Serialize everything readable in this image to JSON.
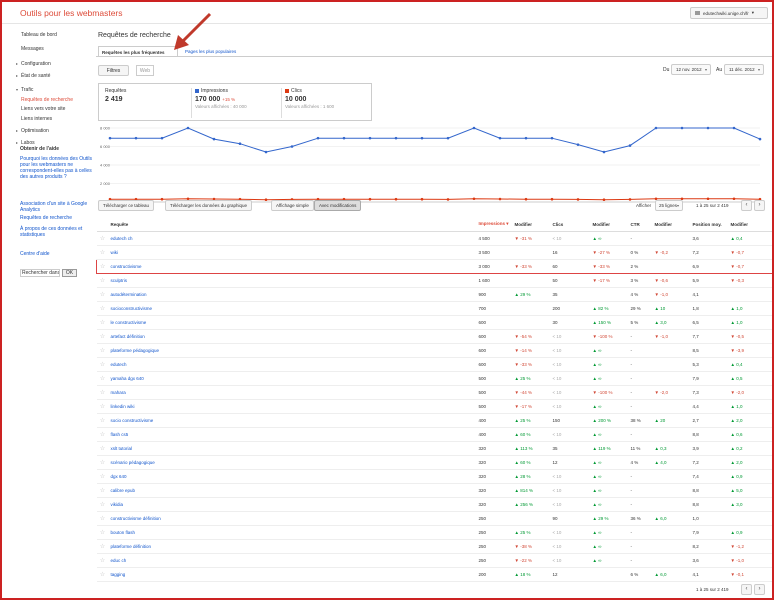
{
  "header": {
    "app_title": "Outils pour les webmasters",
    "account": "edutechwiki.unige.ch/fr"
  },
  "sidebar": {
    "items": [
      {
        "label": "Tableau de bord",
        "type": "top",
        "active": false,
        "arrow": ""
      },
      {
        "label": "Messages",
        "type": "top",
        "active": false,
        "arrow": ""
      },
      {
        "label": "Configuration",
        "type": "sec",
        "active": false,
        "arrow": "▸"
      },
      {
        "label": "État de santé",
        "type": "sec",
        "active": false,
        "arrow": "▸"
      },
      {
        "label": "Trafic",
        "type": "sec",
        "active": false,
        "arrow": "▾"
      },
      {
        "label": "Requêtes de recherche",
        "type": "sub",
        "active": true,
        "arrow": ""
      },
      {
        "label": "Liens vers votre site",
        "type": "sub",
        "active": false,
        "arrow": ""
      },
      {
        "label": "Liens internes",
        "type": "sub",
        "active": false,
        "arrow": ""
      },
      {
        "label": "Optimisation",
        "type": "sec",
        "active": false,
        "arrow": "▸"
      },
      {
        "label": "Labos",
        "type": "sec",
        "active": false,
        "arrow": "▸"
      }
    ],
    "help": {
      "title": "Obtenir de l'aide",
      "links": [
        "Pourquoi les données des Outils pour les webmasters ne correspondent-elles pas à celles des autres produits ?",
        "Association d'un site à Google Analytics",
        "Requêtes de recherche",
        "À propos de ces données et statistiques",
        "Centre d'aide"
      ],
      "search_value": "Rechercher dans",
      "ok_label": "OK"
    }
  },
  "main": {
    "page_title": "Requêtes de recherche",
    "tabs": [
      "Requêtes les plus fréquentes",
      "Pages les plus populaires"
    ],
    "filters_label": "Filtres",
    "web_label": "Web",
    "date": {
      "du_label": "Du",
      "from": "12 nov. 2012",
      "au_label": "Au",
      "to": "11 déc. 2012"
    },
    "kpis": [
      {
        "label": "Requêtes",
        "value": "2 419",
        "delta": "",
        "sub": "",
        "color": ""
      },
      {
        "label": "Impressions",
        "value": "170 000",
        "delta": "+15 %",
        "sub": "Valeurs affichées : 40 000",
        "color": "#3366cc"
      },
      {
        "label": "Clics",
        "value": "10 000",
        "delta": "",
        "sub": "Valeurs affichées : 1 600",
        "color": "#dc3912"
      }
    ],
    "toolbar": {
      "download_table": "Télécharger ce tableau",
      "download_chart": "Télécharger les données du graphique",
      "simple_view": "Affichage simple",
      "with_changes": "Avec modifications",
      "show_label": "Afficher",
      "rows_option": "25 lignes",
      "pager": "1 à 25 sur 2 419"
    },
    "table": {
      "columns": [
        "",
        "Requête",
        "Impressions ▾",
        "Modifier",
        "Clics",
        "Modifier",
        "CTR",
        "Modifier",
        "Position moy.",
        "Modifier"
      ],
      "rows": [
        [
          "edutech ch",
          "4 500",
          "▼ -31 %",
          "< 10",
          "▲ ∞",
          "-",
          "",
          "3,6",
          "▲ 0,4"
        ],
        [
          "wiki",
          "3 500",
          "",
          "16",
          "▼ -27 %",
          "0 %",
          "▼ -0,2",
          "7,2",
          "▼ -0,7"
        ],
        [
          "constructivisme",
          "3 000",
          "▼ -33 %",
          "60",
          "▼ -33 %",
          "2 %",
          "",
          "6,9",
          "▼ -0,7"
        ],
        [
          "sculptris",
          "1 600",
          "",
          "50",
          "▼ -17 %",
          "3 %",
          "▼ -0,6",
          "5,9",
          "▼ -0,3"
        ],
        [
          "autodétermination",
          "900",
          "▲ 29 %",
          "35",
          "",
          "4 %",
          "▼ -1,0",
          "4,1",
          ""
        ],
        [
          "socioconstructivisme",
          "700",
          "",
          "200",
          "▲ 82 %",
          "29 %",
          "▲ 10",
          "1,8",
          "▲ 1,0"
        ],
        [
          "le constructivisme",
          "600",
          "",
          "30",
          "▲ 150 %",
          "5 %",
          "▲ 3,0",
          "6,5",
          "▲ 1,0"
        ],
        [
          "artefact définition",
          "600",
          "▼ -54 %",
          "< 10",
          "▼ -100 %",
          "-",
          "▼ -1,0",
          "7,7",
          "▼ -0,5"
        ],
        [
          "plateforme pédagogique",
          "600",
          "▼ -14 %",
          "< 10",
          "▲ ∞",
          "-",
          "",
          "8,5",
          "▼ -3,9"
        ],
        [
          "edutech",
          "600",
          "▼ -33 %",
          "< 10",
          "▲ ∞",
          "-",
          "",
          "5,3",
          "▲ 0,4"
        ],
        [
          "yamaha dgx 640",
          "500",
          "▲ 25 %",
          "< 10",
          "▲ ∞",
          "-",
          "",
          "7,9",
          "▲ 0,5"
        ],
        [
          "mahara",
          "500",
          "▼ -44 %",
          "< 10",
          "▼ -100 %",
          "-",
          "▼ -2,0",
          "7,3",
          "▼ -2,0"
        ],
        [
          "linkedin wiki",
          "500",
          "▼ -17 %",
          "< 10",
          "▲ ∞",
          "-",
          "",
          "4,4",
          "▲ 1,0"
        ],
        [
          "socio constructivisme",
          "400",
          "▲ 25 %",
          "150",
          "▲ 200 %",
          "38 %",
          "▲ 20",
          "2,7",
          "▲ 2,0"
        ],
        [
          "flash cs5",
          "400",
          "▲ 60 %",
          "< 10",
          "▲ ∞",
          "-",
          "",
          "8,8",
          "▲ 0,6"
        ],
        [
          "xslt tutorial",
          "320",
          "▲ 113 %",
          "35",
          "▲ 119 %",
          "11 %",
          "▲ 0,3",
          "3,9",
          "▲ 0,2"
        ],
        [
          "scénario pédagogique",
          "320",
          "▲ 60 %",
          "12",
          "▲ ∞",
          "4 %",
          "▲ 4,0",
          "7,2",
          "▲ 2,0"
        ],
        [
          "dgx 640",
          "320",
          "▲ 28 %",
          "< 10",
          "▲ ∞",
          "-",
          "",
          "7,4",
          "▲ 0,9"
        ],
        [
          "calibre epub",
          "320",
          "▲ 814 %",
          "< 10",
          "▲ ∞",
          "-",
          "",
          "8,8",
          "▲ 5,0"
        ],
        [
          "vikidia",
          "320",
          "▲ 256 %",
          "< 10",
          "▲ ∞",
          "-",
          "",
          "8,8",
          "▲ 3,0"
        ],
        [
          "constructivisme définition",
          "250",
          "",
          "90",
          "▲ 29 %",
          "36 %",
          "▲ 6,0",
          "1,0",
          ""
        ],
        [
          "bouton flash",
          "250",
          "▲ 25 %",
          "< 10",
          "▲ ∞",
          "-",
          "",
          "7,9",
          "▲ 0,9"
        ],
        [
          "plateforme définition",
          "250",
          "▼ -38 %",
          "< 10",
          "▲ ∞",
          "-",
          "",
          "8,2",
          "▼ -1,2"
        ],
        [
          "educ ch",
          "250",
          "▼ -22 %",
          "< 10",
          "▲ ∞",
          "-",
          "",
          "3,6",
          "▼ -1,0"
        ],
        [
          "tagging",
          "200",
          "▲ 18 %",
          "12",
          "",
          "6 %",
          "▲ 6,0",
          "4,1",
          "▼ -0,1"
        ]
      ]
    },
    "pager_bottom": "1 à 25 sur 2 419"
  },
  "chart_data": {
    "type": "line",
    "categories": [
      "12/11/12",
      "13/11/12",
      "14/11/12",
      "15/11/12",
      "16/11/12",
      "17/11/12",
      "18/11/12",
      "19/11/12",
      "20/11/12",
      "21/11/12",
      "22/11/12",
      "23/11/12",
      "24/11/12",
      "25/11/12",
      "26/11/12",
      "27/11/12",
      "28/11/12",
      "29/11/12",
      "30/11/12",
      "01/12/12",
      "02/12/12",
      "03/12/12",
      "04/12/12",
      "05/12/12",
      "06/12/12",
      "07/12/12"
    ],
    "tick_labels": [
      "12/11/12",
      "18/11/12",
      "20/11/12",
      "24/11/12",
      "28/11/12",
      "02/12/12",
      "06/12/12"
    ],
    "tick_index": [
      0,
      4,
      8,
      12,
      16,
      20,
      24
    ],
    "ylim": [
      0,
      8000
    ],
    "y_ticks": [
      "8 000",
      "6 000",
      "4 000",
      "2 000"
    ],
    "y_tick_values": [
      8000,
      6000,
      4000,
      2000
    ],
    "grid": true,
    "series": [
      {
        "name": "Impressions",
        "color": "#3366cc",
        "values": [
          6900,
          6900,
          6900,
          8000,
          6800,
          6300,
          5400,
          6000,
          6900,
          6900,
          6900,
          6900,
          6900,
          6900,
          8000,
          6900,
          6900,
          6900,
          6200,
          5400,
          6100,
          8000,
          8000,
          8000,
          8000,
          6800
        ]
      },
      {
        "name": "Clics",
        "color": "#dc3912",
        "values": [
          300,
          300,
          300,
          350,
          320,
          300,
          250,
          280,
          300,
          300,
          300,
          300,
          300,
          280,
          350,
          320,
          300,
          300,
          280,
          250,
          280,
          350,
          350,
          350,
          350,
          300
        ]
      }
    ]
  }
}
